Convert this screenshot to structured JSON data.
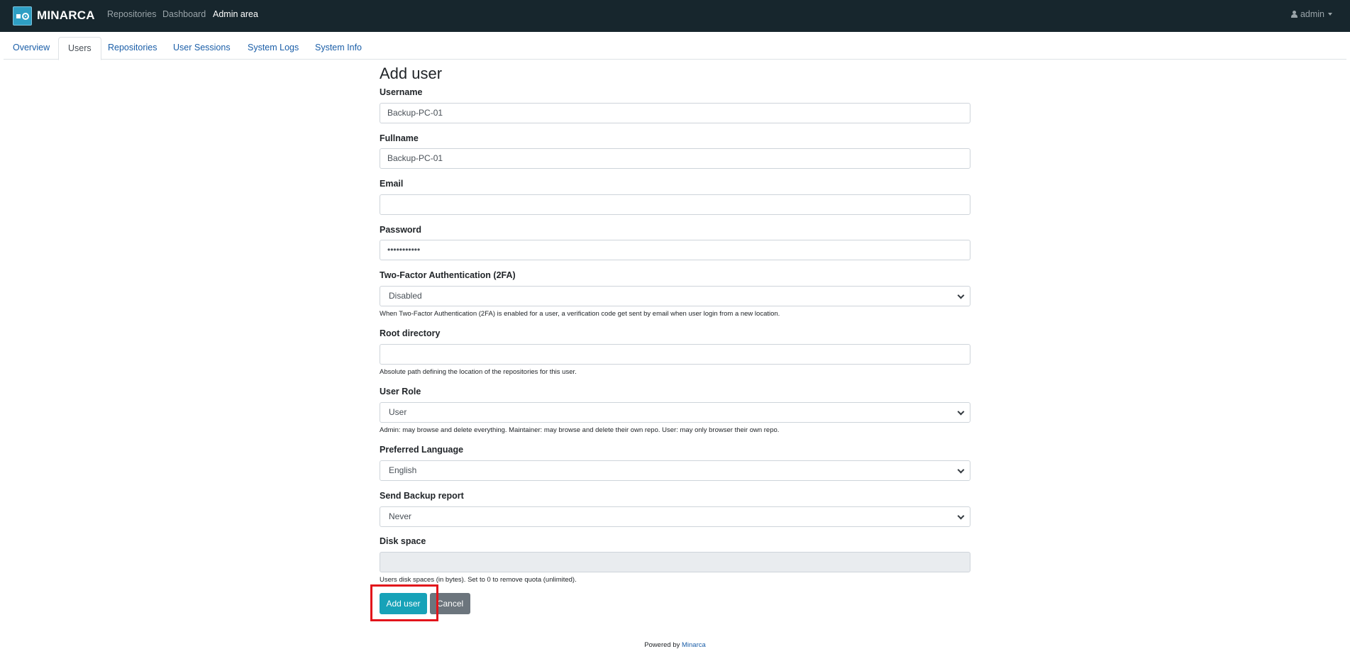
{
  "navbar": {
    "brand": "MINARCA",
    "links": [
      "Repositories",
      "Dashboard",
      "Admin area"
    ],
    "active_link": "Admin area",
    "user": "admin",
    "icons": {
      "logo": "minarca-logo-icon",
      "user": "user-icon",
      "caret": "caret-down-icon"
    }
  },
  "tabs": [
    "Overview",
    "Users",
    "Repositories",
    "User Sessions",
    "System Logs",
    "System Info"
  ],
  "active_tab": "Users",
  "form": {
    "title": "Add user",
    "username": {
      "label": "Username",
      "value": "Backup-PC-01"
    },
    "fullname": {
      "label": "Fullname",
      "value": "Backup-PC-01"
    },
    "email": {
      "label": "Email",
      "value": ""
    },
    "password": {
      "label": "Password",
      "value": "•••••••••••"
    },
    "twofa": {
      "label": "Two-Factor Authentication (2FA)",
      "value": "Disabled",
      "help": "When Two-Factor Authentication (2FA) is enabled for a user, a verification code get sent by email when user login from a new location."
    },
    "root_directory": {
      "label": "Root directory",
      "value": "",
      "help": "Absolute path defining the location of the repositories for this user."
    },
    "user_role": {
      "label": "User Role",
      "value": "User",
      "help": "Admin: may browse and delete everything. Maintainer: may browse and delete their own repo. User: may only browser their own repo."
    },
    "language": {
      "label": "Preferred Language",
      "value": "English"
    },
    "backup_report": {
      "label": "Send Backup report",
      "value": "Never"
    },
    "disk_space": {
      "label": "Disk space",
      "value": "",
      "help": "Users disk spaces (in bytes). Set to 0 to remove quota (unlimited)."
    },
    "submit_label": "Add user",
    "cancel_label": "Cancel"
  },
  "footer": {
    "prefix": "Powered by",
    "link": "Minarca"
  },
  "colors": {
    "navbar_bg": "#17262d",
    "primary_button": "#17a2b8",
    "secondary_button": "#6c757d",
    "highlight": "#e2141b"
  }
}
